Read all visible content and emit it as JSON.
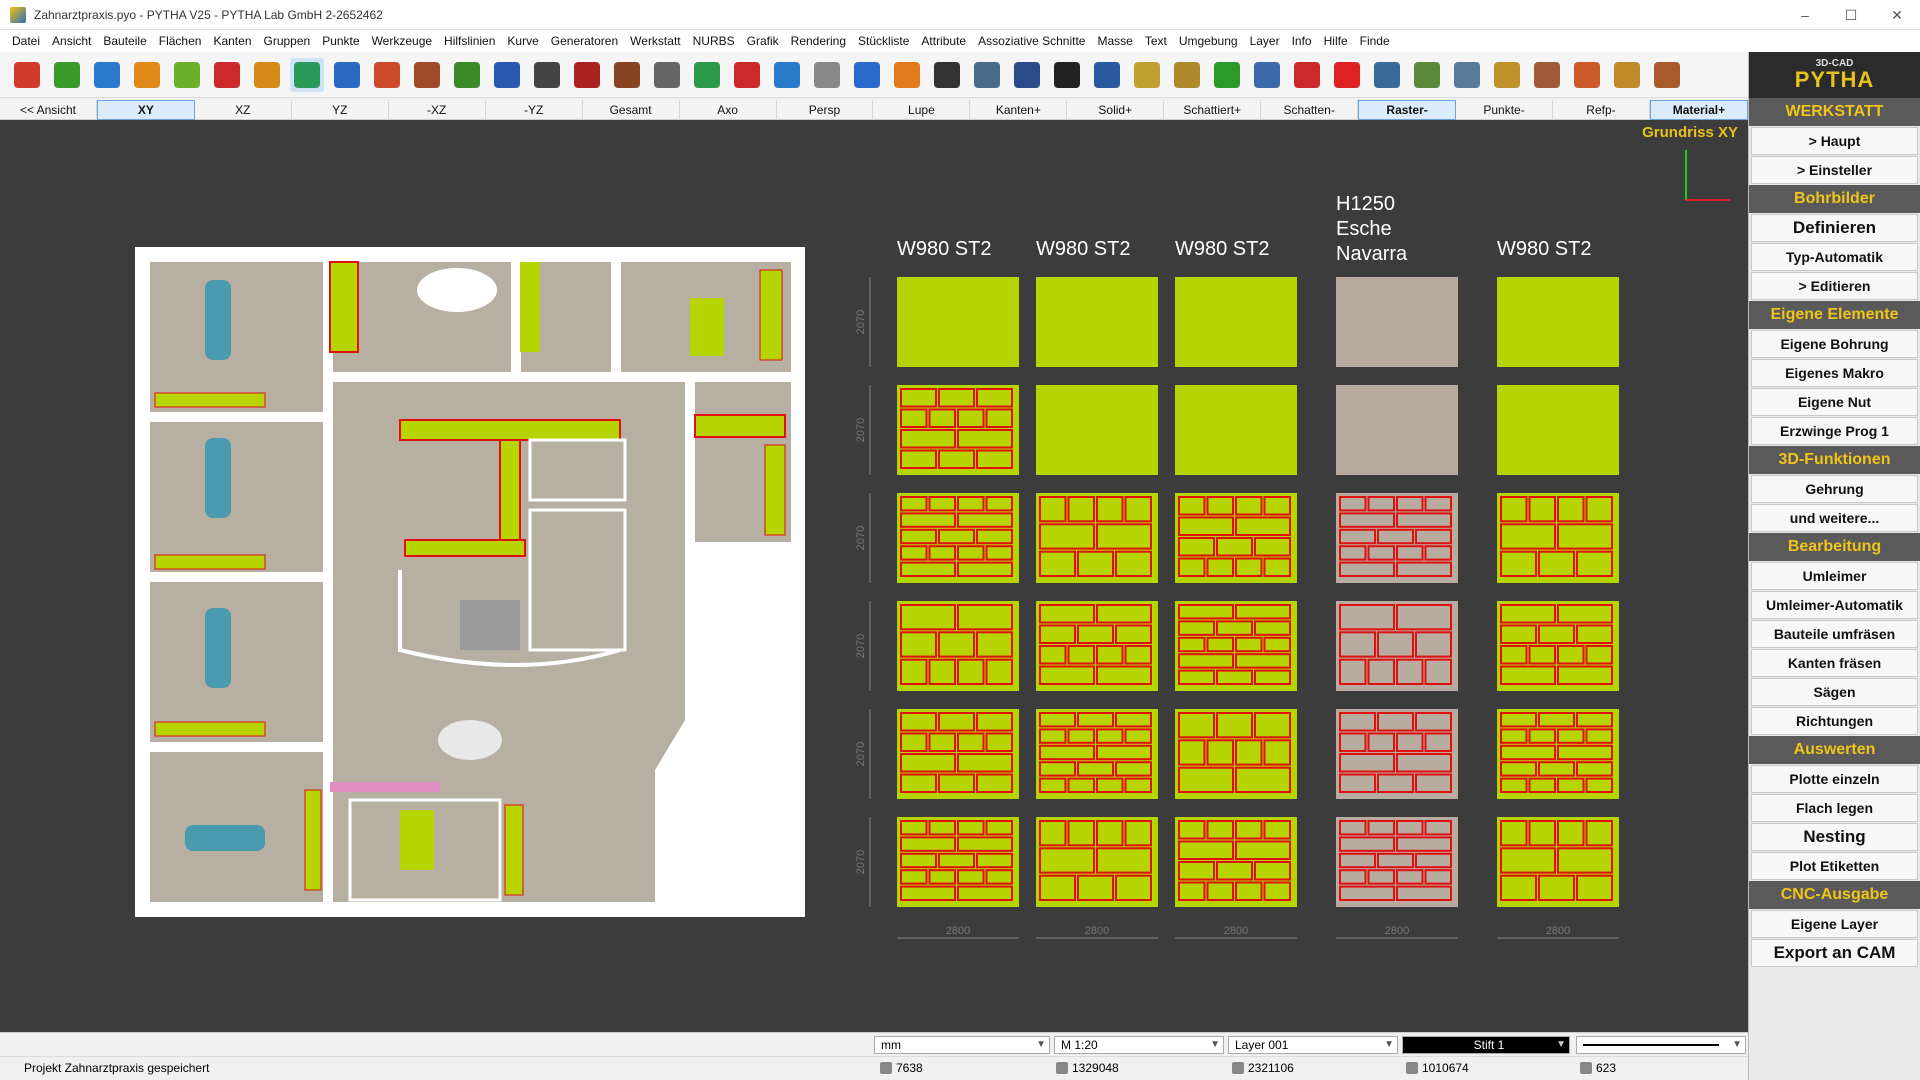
{
  "window": {
    "title": "Zahnarztpraxis.pyo - PYTHA V25 - PYTHA Lab GmbH   2-2652462",
    "controls": [
      "–",
      "☐",
      "✕"
    ]
  },
  "menu": [
    "Datei",
    "Ansicht",
    "Bauteile",
    "Flächen",
    "Kanten",
    "Gruppen",
    "Punkte",
    "Werkzeuge",
    "Hilfslinien",
    "Kurve",
    "Generatoren",
    "Werkstatt",
    "NURBS",
    "Grafik",
    "Rendering",
    "Stückliste",
    "Attribute",
    "Assoziative Schnitte",
    "Masse",
    "Text",
    "Umgebung",
    "Layer",
    "Info",
    "Hilfe",
    "Finde"
  ],
  "toolbar": {
    "tools": [
      {
        "name": "cube-icon",
        "color": "#d23a2a"
      },
      {
        "name": "block-icon",
        "color": "#3a9a2a"
      },
      {
        "name": "surface-icon",
        "color": "#2a7acc"
      },
      {
        "name": "points-icon",
        "color": "#e08a1a"
      },
      {
        "name": "ring-icon",
        "color": "#6ab02a"
      },
      {
        "name": "curve-icon",
        "color": "#cc2a2a"
      },
      {
        "name": "gear-icon",
        "color": "#d58a1a"
      },
      {
        "name": "edge-icon",
        "color": "#2a9a5a"
      },
      {
        "name": "wall-icon",
        "color": "#2a6ac0"
      },
      {
        "name": "tool-hammer-icon",
        "color": "#cc4a2a"
      },
      {
        "name": "tool-pick-icon",
        "color": "#a04a2a"
      },
      {
        "name": "tool-brush-icon",
        "color": "#3a8a2a"
      },
      {
        "name": "measure-icon",
        "color": "#2a5ab0"
      },
      {
        "name": "camera-icon",
        "color": "#444444"
      },
      {
        "name": "spider-icon",
        "color": "#aa2222"
      },
      {
        "name": "eye-icon",
        "color": "#884422"
      },
      {
        "name": "plane-icon",
        "color": "#666666"
      },
      {
        "name": "upload-icon",
        "color": "#2a9a4a"
      },
      {
        "name": "download-icon",
        "color": "#cc2a2a"
      },
      {
        "name": "magnet-icon",
        "color": "#2a7acc"
      },
      {
        "name": "cup-icon",
        "color": "#888888"
      },
      {
        "name": "undo-icon",
        "color": "#2a6acc"
      },
      {
        "name": "redo-icon",
        "color": "#e07a1a"
      },
      {
        "name": "attr-icon",
        "color": "#333333"
      },
      {
        "name": "list-icon",
        "color": "#4a6a8a"
      },
      {
        "name": "lines-icon",
        "color": "#2a4a8a"
      },
      {
        "name": "count-icon",
        "color": "#222222"
      },
      {
        "name": "panel-icon",
        "color": "#2a5aa0"
      },
      {
        "name": "texture-icon",
        "color": "#c0a030"
      },
      {
        "name": "layers-icon",
        "color": "#b08a2a"
      },
      {
        "name": "tree-icon",
        "color": "#2a9a2a"
      },
      {
        "name": "info-icon",
        "color": "#3a6aaa"
      },
      {
        "name": "refresh-icon",
        "color": "#cc2a2a"
      },
      {
        "name": "delete-icon",
        "color": "#dd2222"
      },
      {
        "name": "move-icon",
        "color": "#3a6a9a"
      },
      {
        "name": "rotate-icon",
        "color": "#5a8a3a"
      },
      {
        "name": "mirror-icon",
        "color": "#5a7a9a"
      },
      {
        "name": "nesting-icon",
        "color": "#c0902a"
      },
      {
        "name": "cnc-icon",
        "color": "#a05a3a"
      },
      {
        "name": "edgeband-icon",
        "color": "#cc5a2a"
      },
      {
        "name": "label-icon",
        "color": "#c08a2a"
      },
      {
        "name": "dimension-icon",
        "color": "#aa5a2a"
      }
    ]
  },
  "viewbar": [
    "<< Ansicht",
    "XY",
    "XZ",
    "YZ",
    "-XZ",
    "-YZ",
    "Gesamt",
    "Axo",
    "Persp",
    "Lupe",
    "Kanten+",
    "Solid+",
    "Schattiert+",
    "Schatten-",
    "Raster-",
    "Punkte-",
    "Refp-",
    "Material+"
  ],
  "viewbar_active": [
    "XY",
    "Raster-",
    "Material+"
  ],
  "canvas": {
    "view_label": "Grundriss XY",
    "sheet_headers": [
      "W980 ST2",
      "W980 ST2",
      "W980 ST2",
      "H1250",
      "Esche",
      "Navarra",
      "W980 ST2"
    ],
    "row_dims": [
      "2070",
      "2070",
      "2070",
      "2070",
      "2070",
      "2070"
    ],
    "col_dims": [
      "2800",
      "2800",
      "2800",
      "2800",
      "2800"
    ],
    "colors": {
      "bg": "#3c3c3c",
      "floor": "#b8afa3",
      "wall": "#ffffff",
      "green": "#b5d400",
      "red": "#e01010",
      "wood": "#b8aca0"
    }
  },
  "side": {
    "logo_small": "3D-CAD",
    "logo": "PYTHA",
    "items": [
      {
        "type": "section",
        "label": "WERKSTATT"
      },
      {
        "type": "button",
        "label": "> Haupt",
        "name": "haupt-button"
      },
      {
        "type": "button",
        "label": "> Einsteller",
        "name": "einsteller-button"
      },
      {
        "type": "section",
        "label": "Bohrbilder"
      },
      {
        "type": "button",
        "label": "Definieren",
        "name": "definieren-button",
        "big": true
      },
      {
        "type": "button",
        "label": "Typ-Automatik",
        "name": "typ-automatik-button"
      },
      {
        "type": "button",
        "label": "> Editieren",
        "name": "editieren-button"
      },
      {
        "type": "section",
        "label": "Eigene Elemente"
      },
      {
        "type": "button",
        "label": "Eigene Bohrung",
        "name": "eigene-bohrung-button"
      },
      {
        "type": "button",
        "label": "Eigenes Makro",
        "name": "eigenes-makro-button"
      },
      {
        "type": "button",
        "label": "Eigene Nut",
        "name": "eigene-nut-button"
      },
      {
        "type": "button",
        "label": "Erzwinge Prog 1",
        "name": "erzwinge-prog-button"
      },
      {
        "type": "section",
        "label": "3D-Funktionen"
      },
      {
        "type": "button",
        "label": "Gehrung",
        "name": "gehrung-button"
      },
      {
        "type": "button",
        "label": "und weitere...",
        "name": "und-weitere-button"
      },
      {
        "type": "section",
        "label": "Bearbeitung"
      },
      {
        "type": "button",
        "label": "Umleimer",
        "name": "umleimer-button"
      },
      {
        "type": "button",
        "label": "Umleimer-Automatik",
        "name": "umleimer-automatik-button"
      },
      {
        "type": "button",
        "label": "Bauteile umfräsen",
        "name": "bauteile-umfraesen-button"
      },
      {
        "type": "button",
        "label": "Kanten fräsen",
        "name": "kanten-fraesen-button"
      },
      {
        "type": "button",
        "label": "Sägen",
        "name": "saegen-button"
      },
      {
        "type": "button",
        "label": "Richtungen",
        "name": "richtungen-button"
      },
      {
        "type": "section",
        "label": "Auswerten"
      },
      {
        "type": "button",
        "label": "Plotte einzeln",
        "name": "plotte-einzeln-button"
      },
      {
        "type": "button",
        "label": "Flach legen",
        "name": "flach-legen-button"
      },
      {
        "type": "button",
        "label": "Nesting",
        "name": "nesting-button",
        "big": true
      },
      {
        "type": "button",
        "label": "Plot Etiketten",
        "name": "plot-etiketten-button"
      },
      {
        "type": "section",
        "label": "CNC-Ausgabe"
      },
      {
        "type": "button",
        "label": "Eigene Layer",
        "name": "eigene-layer-button"
      },
      {
        "type": "button",
        "label": "Export an CAM",
        "name": "export-cam-button",
        "big": true
      }
    ]
  },
  "status": {
    "unit": "mm",
    "scale": "M 1:20",
    "layer": "Layer 001",
    "pen": "Stift 1",
    "message": "Projekt Zahnarztpraxis gespeichert",
    "counts": [
      "7638",
      "1329048",
      "2321106",
      "1010674",
      "623"
    ]
  }
}
